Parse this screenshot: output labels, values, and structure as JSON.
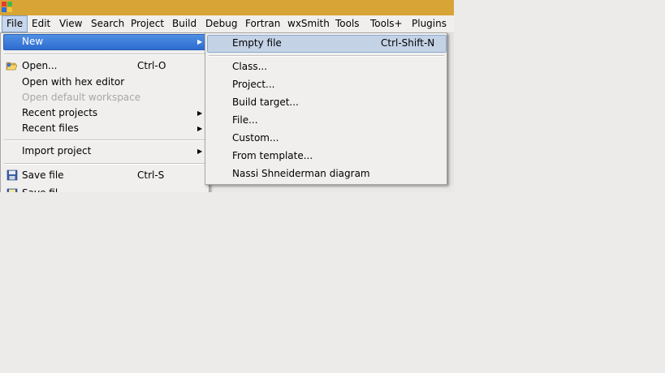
{
  "colors": {
    "titlebar": "#d8a436",
    "menu_bg": "#f0efee",
    "highlight": "#3a7ad8",
    "highlight_light": "#c4d2e6",
    "disabled_text": "#a8a7a5",
    "desktop": "#ecebe9"
  },
  "titlebar": {
    "icon": "app-icon"
  },
  "menubar": {
    "file": "File",
    "edit": "Edit",
    "view": "View",
    "search": "Search",
    "project": "Project",
    "build": "Build",
    "debug": "Debug",
    "fortran": "Fortran",
    "wxsmith": "wxSmith",
    "tools": "Tools",
    "tools_plus": "Tools+",
    "plugins": "Plugins"
  },
  "file_menu": {
    "new": "New",
    "open": "Open...",
    "open_shortcut": "Ctrl-O",
    "open_hex": "Open with hex editor",
    "open_default_ws": "Open default workspace",
    "recent_projects": "Recent projects",
    "recent_files": "Recent files",
    "import_project": "Import project",
    "save_file": "Save file",
    "save_file_shortcut": "Ctrl-S",
    "save_partial": "Save fil"
  },
  "new_submenu": {
    "empty_file": "Empty file",
    "empty_file_shortcut": "Ctrl-Shift-N",
    "class": "Class...",
    "project": "Project...",
    "build_target": "Build target...",
    "file": "File...",
    "custom": "Custom...",
    "from_template": "From template...",
    "nassi": "Nassi Shneiderman diagram"
  },
  "icons": {
    "submenu_arrow": "▶",
    "open": "folder-open-icon",
    "save": "floppy-disk-icon"
  }
}
